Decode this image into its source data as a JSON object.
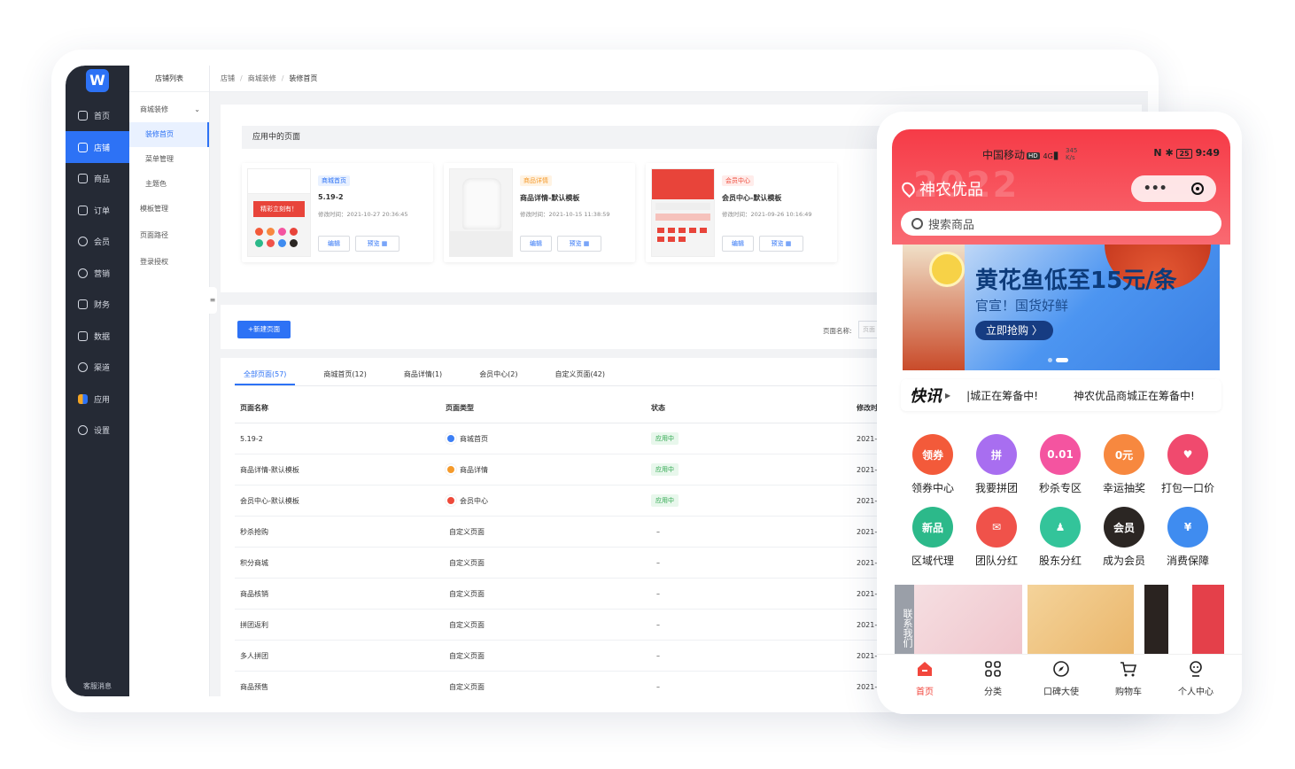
{
  "admin": {
    "logo": "W",
    "rail": [
      {
        "label": "首页",
        "icon": "home-icon"
      },
      {
        "label": "店铺",
        "icon": "store-icon",
        "active": true
      },
      {
        "label": "商品",
        "icon": "product-icon"
      },
      {
        "label": "订单",
        "icon": "order-icon"
      },
      {
        "label": "会员",
        "icon": "member-icon"
      },
      {
        "label": "营销",
        "icon": "marketing-icon"
      },
      {
        "label": "财务",
        "icon": "finance-icon"
      },
      {
        "label": "数据",
        "icon": "data-icon"
      },
      {
        "label": "渠道",
        "icon": "channel-icon"
      },
      {
        "label": "应用",
        "icon": "apps-icon"
      },
      {
        "label": "设置",
        "icon": "settings-icon"
      }
    ],
    "rail_bottom": "客服消息",
    "subnav": {
      "title": "店铺列表",
      "group": "商城装修",
      "children": [
        "装修首页",
        "菜单管理",
        "主题色"
      ],
      "items": [
        "模板管理",
        "页面路径",
        "登录授权"
      ]
    },
    "breadcrumb": [
      "店铺",
      "商城装修",
      "装修首页"
    ],
    "applied": {
      "title": "应用中的页面",
      "cards": [
        {
          "tag": "商城首页",
          "name": "5.19-2",
          "time": "修改时间：2021-10-27 20:36:45",
          "edit": "编辑",
          "preview": "预览 ▦",
          "banner_text": "精彩立刻有！"
        },
        {
          "tag": "商品详情",
          "name": "商品详情-默认模板",
          "time": "修改时间：2021-10-15 11:38:59",
          "edit": "编辑",
          "preview": "预览 ▦"
        },
        {
          "tag": "会员中心",
          "name": "会员中心-默认模板",
          "time": "修改时间：2021-09-26 10:16:49",
          "edit": "编辑",
          "preview": "预览 ▦"
        }
      ]
    },
    "list": {
      "new_button": "+新建页面",
      "search_label": "页面名称:",
      "search_placeholder": "页面",
      "tabs": [
        "全部页面(57)",
        "商城首页(12)",
        "商品详情(1)",
        "会员中心(2)",
        "自定义页面(42)"
      ],
      "headers": [
        "页面名称",
        "页面类型",
        "状态",
        "修改时"
      ],
      "rows": [
        {
          "name": "5.19-2",
          "type": "商城首页",
          "type_color": "#3d7ff5",
          "status": "应用中",
          "time": "2021-"
        },
        {
          "name": "商品详情-默认模板",
          "type": "商品详情",
          "type_color": "#f59a2b",
          "status": "应用中",
          "time": "2021-"
        },
        {
          "name": "会员中心-默认模板",
          "type": "会员中心",
          "type_color": "#ee4a3a",
          "status": "应用中",
          "time": "2021-"
        },
        {
          "name": "秒杀抢购",
          "type": "自定义页面",
          "status": "–",
          "time": "2021-"
        },
        {
          "name": "积分商城",
          "type": "自定义页面",
          "status": "–",
          "time": "2021-"
        },
        {
          "name": "商品核销",
          "type": "自定义页面",
          "status": "–",
          "time": "2021-"
        },
        {
          "name": "拼团返利",
          "type": "自定义页面",
          "status": "–",
          "time": "2021-"
        },
        {
          "name": "多人拼团",
          "type": "自定义页面",
          "status": "–",
          "time": "2021-"
        },
        {
          "name": "商品预售",
          "type": "自定义页面",
          "status": "–",
          "time": "2021-"
        }
      ]
    }
  },
  "phone": {
    "carrier": "中国移动",
    "hd": "HD",
    "net": "4G",
    "speed_value": "345",
    "speed_unit": "K/s",
    "battery": "25",
    "time": "9:49",
    "deco_year": "2022",
    "store_name": "神农优品",
    "search_placeholder": "搜索商品",
    "banner": {
      "title": "黄花鱼低至15元/条",
      "subtitle": "官宣！国货好鲜",
      "button": "立即抢购 〉"
    },
    "news": {
      "logo": "快讯",
      "text1": "|城正在筹备中!",
      "text2": "神农优品商城正在筹备中!"
    },
    "grid": [
      {
        "label": "领券中心",
        "badge": "领券",
        "color": "#f35a3a"
      },
      {
        "label": "我要拼团",
        "badge": "拼",
        "color": "#a86ef0"
      },
      {
        "label": "秒杀专区",
        "badge": "0.01",
        "color": "#f454a0"
      },
      {
        "label": "幸运抽奖",
        "badge": "0元",
        "color": "#f7883f"
      },
      {
        "label": "打包一口价",
        "badge": "♥",
        "color": "#f04a6e"
      },
      {
        "label": "区域代理",
        "badge": "新品",
        "color": "#2cb98a"
      },
      {
        "label": "团队分红",
        "badge": "✉",
        "color": "#f0524a"
      },
      {
        "label": "股东分红",
        "badge": "♟",
        "color": "#33c49a"
      },
      {
        "label": "成为会员",
        "badge": "会员",
        "color": "#2b2623"
      },
      {
        "label": "消费保障",
        "badge": "¥",
        "color": "#3f8cf0"
      }
    ],
    "contact": "联系我们",
    "tabbar": [
      {
        "label": "首页",
        "icon": "home-icon",
        "active": true
      },
      {
        "label": "分类",
        "icon": "category-icon"
      },
      {
        "label": "口碑大使",
        "icon": "compass-icon"
      },
      {
        "label": "购物车",
        "icon": "cart-icon"
      },
      {
        "label": "个人中心",
        "icon": "profile-icon"
      }
    ]
  }
}
